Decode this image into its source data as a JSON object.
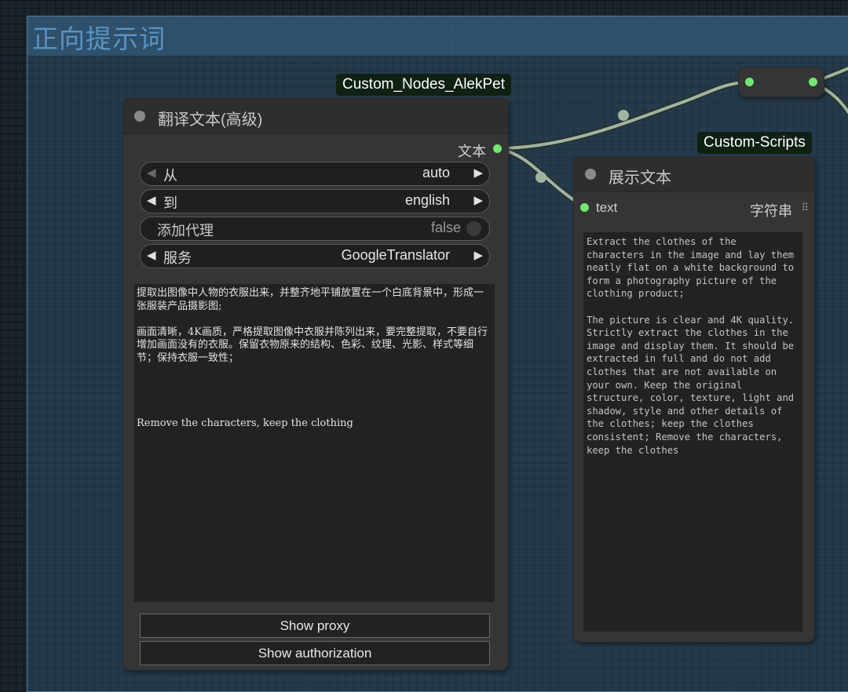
{
  "group": {
    "title": "正向提示词"
  },
  "badges": {
    "alekpet": "Custom_Nodes_AlekPet",
    "scripts": "Custom-Scripts"
  },
  "translate_node": {
    "title": "翻译文本(高级)",
    "output_label": "文本",
    "widgets": [
      {
        "label": "从",
        "value": "auto"
      },
      {
        "label": "到",
        "value": "english"
      },
      {
        "label": "添加代理",
        "value": "false"
      },
      {
        "label": "服务",
        "value": "GoogleTranslator"
      }
    ],
    "text": "提取出图像中人物的衣服出来，并整齐地平铺放置在一个白底背景中，形成一张服装产品摄影图;\n\n画面清晰，4K画质，严格提取图像中衣服并陈列出来，要完整提取，不要自行增加画面没有的衣服。保留衣物原来的结构、色彩、纹理、光影、样式等细节；保持衣服一致性；\n\n\n\n\nRemove the characters, keep the clothing",
    "buttons": {
      "proxy": "Show proxy",
      "auth": "Show authorization"
    }
  },
  "display_node": {
    "title": "展示文本",
    "input_label": "text",
    "output_type": "字符串",
    "text": "Extract the clothes of the characters in the image and lay them neatly flat on a white background to form a photography picture of the clothing product;\n\nThe picture is clear and 4K quality. Strictly extract the clothes in the image and display them. It should be extracted in full and do not add clothes that are not available on your own. Keep the original structure, color, texture, light and shadow, style and other details of the clothes; keep the clothes consistent; Remove the characters, keep the clothes"
  },
  "colors": {
    "slot": "#72e872",
    "wire": "#9fb3a0",
    "group": "#5a93c2"
  }
}
